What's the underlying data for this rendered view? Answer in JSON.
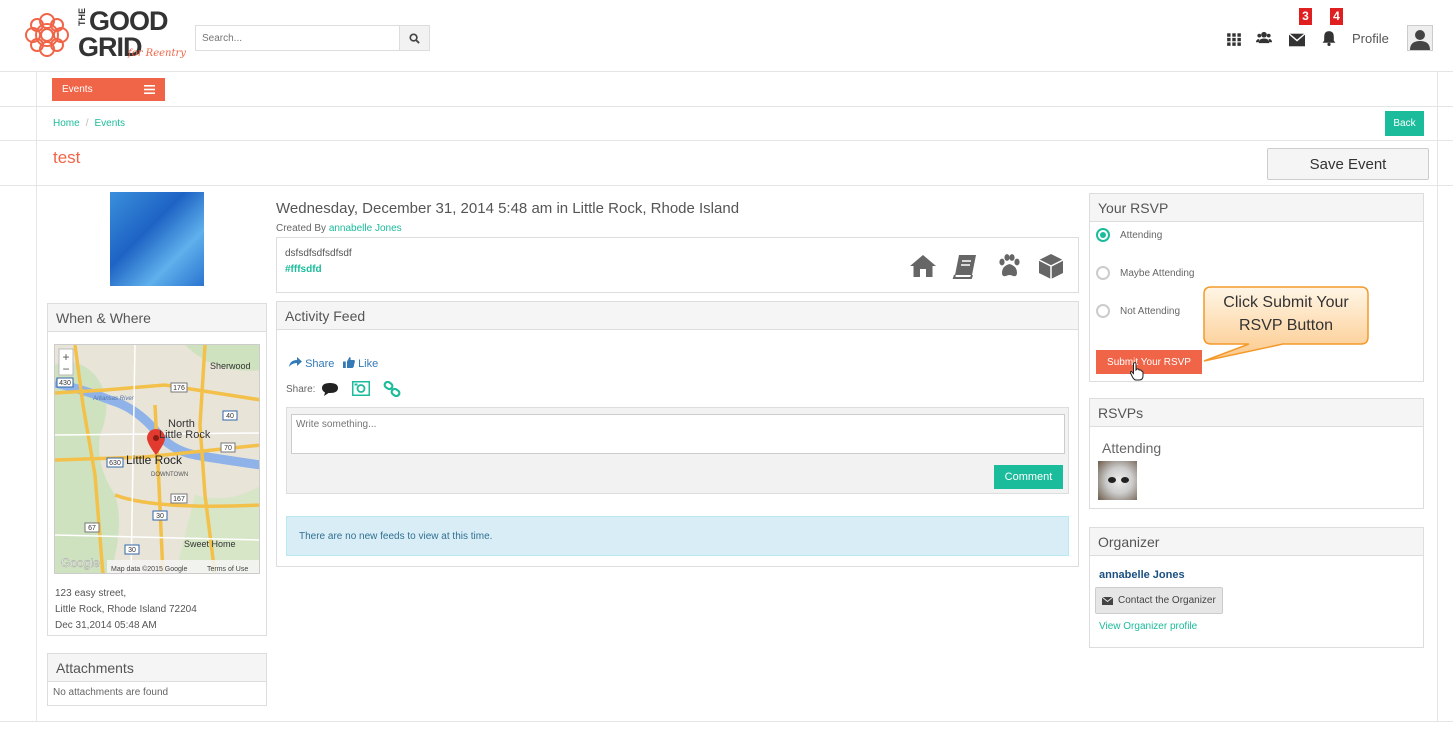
{
  "header": {
    "logo": {
      "the": "THE",
      "line1": "GOOD",
      "line2": "GRID",
      "tagline": "for Reentry"
    },
    "search_placeholder": "Search...",
    "badges": {
      "messages": "3",
      "notifications": "4"
    },
    "profile_label": "Profile"
  },
  "menu": {
    "events_label": "Events"
  },
  "breadcrumb": {
    "home": "Home",
    "separator": "/",
    "current": "Events"
  },
  "back_label": "Back",
  "page_title": "test",
  "save_event_label": "Save Event",
  "when_where": {
    "title": "When & Where",
    "map": {
      "labels": [
        "Sherwood",
        "North",
        "Little Rock",
        "Little Rock",
        "DOWNTOWN",
        "Sweet Home",
        "Arkansas River"
      ],
      "route_shields": [
        "430",
        "176",
        "40",
        "70",
        "630",
        "167",
        "30",
        "67",
        "30"
      ],
      "zoom_in": "+",
      "zoom_out": "−",
      "attribution": "Map data ©2015 Google",
      "terms": "Terms of Use",
      "google": "Google"
    },
    "address_line1": "123 easy street,",
    "address_line2": "Little Rock, Rhode Island 72204",
    "datetime": "Dec 31,2014 05:48 AM"
  },
  "attachments": {
    "title": "Attachments",
    "empty": "No attachments are found"
  },
  "event": {
    "date_line": "Wednesday, December 31, 2014 5:48 am in Little Rock, Rhode Island",
    "created_by_prefix": "Created By",
    "created_by_name": "annabelle Jones",
    "description": "dsfsdfsdfsdfsdf",
    "tag": "#fffsdfd",
    "category_icons": [
      "home-icon",
      "book-icon",
      "paw-icon",
      "cube-icon"
    ]
  },
  "activity": {
    "title": "Activity Feed",
    "share_label": "Share",
    "like_label": "Like",
    "share_prefix": "Share:",
    "write_placeholder": "Write something...",
    "comment_label": "Comment",
    "empty_message": "There are no new feeds to view at this time."
  },
  "rsvp": {
    "title": "Your RSVP",
    "options": [
      {
        "label": "Attending",
        "selected": true
      },
      {
        "label": "Maybe Attending",
        "selected": false
      },
      {
        "label": "Not Attending",
        "selected": false
      }
    ],
    "submit_label": "Submit Your RSVP",
    "callout_line1": "Click Submit Your",
    "callout_line2": "RSVP Button"
  },
  "rsvps": {
    "title": "RSVPs",
    "attending_label": "Attending"
  },
  "organizer": {
    "title": "Organizer",
    "name": "annabelle Jones",
    "contact_label": "Contact the Organizer",
    "view_profile_label": "View Organizer profile"
  },
  "colors": {
    "accent": "#f06548",
    "teal": "#1bbc9b",
    "badge": "#e02020"
  }
}
